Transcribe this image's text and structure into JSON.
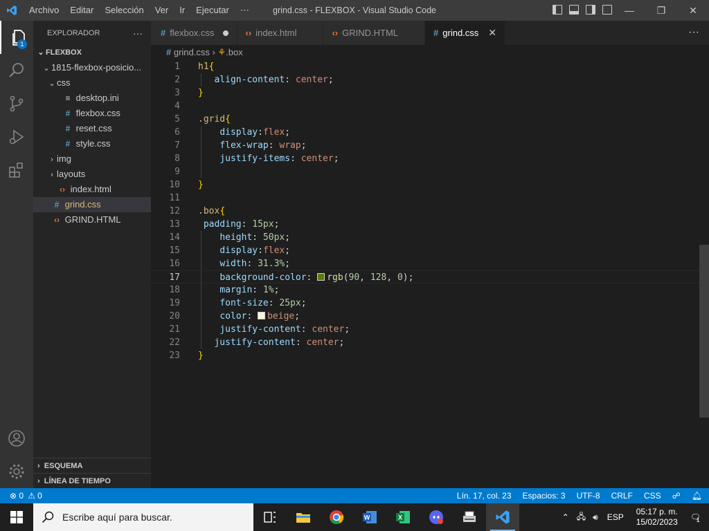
{
  "titlebar": {
    "menu": [
      "Archivo",
      "Editar",
      "Selección",
      "Ver",
      "Ir",
      "Ejecutar",
      "⋯"
    ],
    "title": "grind.css - FLEXBOX - Visual Studio Code",
    "controls": [
      "—",
      "❐",
      "✕"
    ]
  },
  "activity_bar": {
    "explorer_badge": "1",
    "items": [
      "files-icon",
      "search-icon",
      "source-control-icon",
      "run-debug-icon",
      "extensions-icon"
    ],
    "bottom": [
      "account-icon",
      "settings-gear-icon"
    ]
  },
  "sidebar": {
    "title": "EXPLORADOR",
    "more": "···",
    "root": "FLEXBOX",
    "tree": [
      {
        "label": "1815-flexbox-posicio...",
        "indent": 1,
        "twisty": "⌄",
        "icon": ""
      },
      {
        "label": "css",
        "indent": 2,
        "twisty": "⌄",
        "icon": ""
      },
      {
        "label": "desktop.ini",
        "indent": 3,
        "twisty": "",
        "icon": "≡",
        "color": "#cccccc"
      },
      {
        "label": "flexbox.css",
        "indent": 3,
        "twisty": "",
        "icon": "#",
        "color": "#519aba"
      },
      {
        "label": "reset.css",
        "indent": 3,
        "twisty": "",
        "icon": "#",
        "color": "#519aba"
      },
      {
        "label": "style.css",
        "indent": 3,
        "twisty": "",
        "icon": "#",
        "color": "#519aba"
      },
      {
        "label": "img",
        "indent": 2,
        "twisty": "›",
        "icon": ""
      },
      {
        "label": "layouts",
        "indent": 2,
        "twisty": "›",
        "icon": ""
      },
      {
        "label": "index.html",
        "indent": 2,
        "twisty": "",
        "icon": "<>",
        "color": "#e37933"
      },
      {
        "label": "grind.css",
        "indent": 1,
        "twisty": "",
        "icon": "#",
        "color": "#519aba",
        "selected": true
      },
      {
        "label": "GRIND.HTML",
        "indent": 1,
        "twisty": "",
        "icon": "<>",
        "color": "#e37933"
      }
    ],
    "outline": "ESQUEMA",
    "timeline": "LÍNEA DE TIEMPO"
  },
  "tabs": [
    {
      "label": "flexbox.css",
      "icon": "#",
      "color": "#519aba",
      "modified": true,
      "active": false
    },
    {
      "label": "index.html",
      "icon": "<>",
      "color": "#e37933",
      "active": false
    },
    {
      "label": "GRIND.HTML",
      "icon": "<>",
      "color": "#e37933",
      "active": false
    },
    {
      "label": "grind.css",
      "icon": "#",
      "color": "#519aba",
      "active": true,
      "close": "✕"
    }
  ],
  "tabs_more": "···",
  "breadcrumb": {
    "file": "grind.css",
    "sep": "›",
    "symbol": ".box"
  },
  "editor": {
    "current_line": 17,
    "lines": [
      {
        "n": "1",
        "t": [
          [
            "sel",
            "h1"
          ],
          [
            "br",
            "{"
          ]
        ]
      },
      {
        "n": "2",
        "t": [
          [
            "pn",
            "   "
          ],
          [
            "prop",
            "align-content"
          ],
          [
            "pn",
            ": "
          ],
          [
            "val",
            "center"
          ],
          [
            "pn",
            ";"
          ]
        ]
      },
      {
        "n": "3",
        "t": [
          [
            "br",
            "}"
          ]
        ]
      },
      {
        "n": "4",
        "t": []
      },
      {
        "n": "5",
        "t": [
          [
            "sel",
            ".grid"
          ],
          [
            "br",
            "{"
          ]
        ]
      },
      {
        "n": "6",
        "t": [
          [
            "pn",
            "    "
          ],
          [
            "prop",
            "display"
          ],
          [
            "pn",
            ":"
          ],
          [
            "val",
            "flex"
          ],
          [
            "pn",
            ";"
          ]
        ]
      },
      {
        "n": "7",
        "t": [
          [
            "pn",
            "    "
          ],
          [
            "prop",
            "flex-wrap"
          ],
          [
            "pn",
            ": "
          ],
          [
            "val",
            "wrap"
          ],
          [
            "pn",
            ";"
          ]
        ]
      },
      {
        "n": "8",
        "t": [
          [
            "pn",
            "    "
          ],
          [
            "prop",
            "justify-items"
          ],
          [
            "pn",
            ": "
          ],
          [
            "val",
            "center"
          ],
          [
            "pn",
            ";"
          ]
        ]
      },
      {
        "n": "9",
        "t": []
      },
      {
        "n": "10",
        "t": [
          [
            "br",
            "}"
          ]
        ]
      },
      {
        "n": "11",
        "t": []
      },
      {
        "n": "12",
        "t": [
          [
            "sel",
            ".box"
          ],
          [
            "br",
            "{"
          ]
        ]
      },
      {
        "n": "13",
        "t": [
          [
            "pn",
            " "
          ],
          [
            "prop",
            "padding"
          ],
          [
            "pn",
            ": "
          ],
          [
            "num",
            "15px"
          ],
          [
            "pn",
            ";"
          ]
        ]
      },
      {
        "n": "14",
        "t": [
          [
            "pn",
            "    "
          ],
          [
            "prop",
            "height"
          ],
          [
            "pn",
            ": "
          ],
          [
            "num",
            "50px"
          ],
          [
            "pn",
            ";"
          ]
        ]
      },
      {
        "n": "15",
        "t": [
          [
            "pn",
            "    "
          ],
          [
            "prop",
            "display"
          ],
          [
            "pn",
            ":"
          ],
          [
            "val",
            "flex"
          ],
          [
            "pn",
            ";"
          ]
        ]
      },
      {
        "n": "16",
        "t": [
          [
            "pn",
            "    "
          ],
          [
            "prop",
            "width"
          ],
          [
            "pn",
            ": "
          ],
          [
            "num",
            "31.3%"
          ],
          [
            "pn",
            ";"
          ]
        ]
      },
      {
        "n": "17",
        "t": [
          [
            "pn",
            "    "
          ],
          [
            "prop",
            "background-color"
          ],
          [
            "pn",
            ": "
          ],
          [
            "swatch",
            "#5a8000"
          ],
          [
            "fn",
            "rgb"
          ],
          [
            "pn",
            "("
          ],
          [
            "num",
            "90"
          ],
          [
            "pn",
            ", "
          ],
          [
            "num",
            "128"
          ],
          [
            "pn",
            ", "
          ],
          [
            "num",
            "0"
          ],
          [
            "pn",
            ");"
          ]
        ]
      },
      {
        "n": "18",
        "t": [
          [
            "pn",
            "    "
          ],
          [
            "prop",
            "margin"
          ],
          [
            "pn",
            ": "
          ],
          [
            "num",
            "1%"
          ],
          [
            "pn",
            ";"
          ]
        ]
      },
      {
        "n": "19",
        "t": [
          [
            "pn",
            "    "
          ],
          [
            "prop",
            "font-size"
          ],
          [
            "pn",
            ": "
          ],
          [
            "num",
            "25px"
          ],
          [
            "pn",
            ";"
          ]
        ]
      },
      {
        "n": "20",
        "t": [
          [
            "pn",
            "    "
          ],
          [
            "prop",
            "color"
          ],
          [
            "pn",
            ": "
          ],
          [
            "swatch",
            "#f5f5dc"
          ],
          [
            "val",
            "beige"
          ],
          [
            "pn",
            ";"
          ]
        ]
      },
      {
        "n": "21",
        "t": [
          [
            "pn",
            "    "
          ],
          [
            "prop",
            "justify-content"
          ],
          [
            "pn",
            ": "
          ],
          [
            "val",
            "center"
          ],
          [
            "pn",
            ";"
          ]
        ]
      },
      {
        "n": "22",
        "t": [
          [
            "pn",
            "   "
          ],
          [
            "prop",
            "justify-content"
          ],
          [
            "pn",
            ": "
          ],
          [
            "val",
            "center"
          ],
          [
            "pn",
            ";"
          ]
        ]
      },
      {
        "n": "23",
        "t": [
          [
            "br",
            "}"
          ]
        ]
      }
    ]
  },
  "status": {
    "errors": "⊗ 0",
    "warnings": "⚠ 0",
    "position": "Lín. 17, col. 23",
    "spaces": "Espacios: 3",
    "encoding": "UTF-8",
    "eol": "CRLF",
    "language": "CSS"
  },
  "taskbar": {
    "search_placeholder": "Escribe aquí para buscar.",
    "apps": [
      "task-view-icon",
      "file-explorer-icon",
      "chrome-icon",
      "word-icon",
      "excel-icon",
      "discord-icon",
      "scanner-icon",
      "vscode-icon"
    ],
    "tray_lang": "ESP",
    "time": "05:17 p. m.",
    "date": "15/02/2023",
    "notifications": "1"
  }
}
